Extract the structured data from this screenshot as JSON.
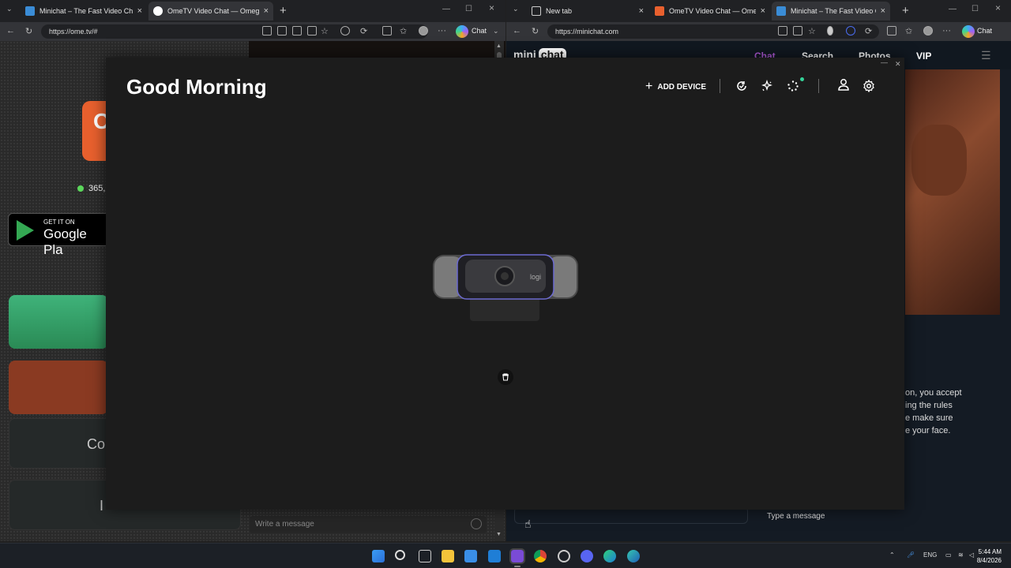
{
  "left_window": {
    "tabs": [
      {
        "title": "Minichat – The Fast Video Chat",
        "active": false
      },
      {
        "title": "OmeTV Video Chat — Omegle",
        "active": true
      }
    ],
    "url": "https://ome.tv/#",
    "chat_label": "Chat",
    "ome": {
      "logo_letter": "O",
      "online_count": "365,",
      "gplay_small": "GET IT ON",
      "gplay_big": "Google Pla",
      "btn_country": "Cou",
      "btn_bottom": "I",
      "message_placeholder": "Write a message"
    }
  },
  "right_window": {
    "tabs": [
      {
        "title": "New tab",
        "active": false
      },
      {
        "title": "OmeTV Video Chat — Omegle R",
        "active": false
      },
      {
        "title": "Minichat – The Fast Video Ch",
        "active": true
      }
    ],
    "url": "https://minichat.com",
    "chat_label": "Chat",
    "mini": {
      "logo_a": "mini",
      "logo_b": "chat",
      "nav": [
        "Chat",
        "Search",
        "Photos",
        "VIP"
      ],
      "rules": [
        "on, you accept",
        "ing the rules",
        "e make sure",
        "e your face."
      ],
      "type_placeholder": "Type a message"
    }
  },
  "overlay": {
    "title": "Good Morning",
    "add_device": "ADD DEVICE",
    "device_brand": "logi",
    "icons": [
      "refresh-check-icon",
      "sparkle-icon",
      "loading-dots-icon",
      "user-icon",
      "gear-icon",
      "trash-icon"
    ]
  },
  "taskbar": {
    "language": "ENG",
    "time": "5:44 AM",
    "date": "8/4/2026",
    "icons": [
      "windows-start-icon",
      "search-icon",
      "task-view-icon",
      "file-explorer-icon",
      "store-icon",
      "mail-icon",
      "app-icon",
      "chrome-icon",
      "tool-icon",
      "discord-icon",
      "edge-icon",
      "edge-dev-icon"
    ]
  },
  "colors": {
    "accent_green": "#34d399",
    "ome_orange": "#e8602e",
    "minichat_purple": "#b05ad8"
  }
}
